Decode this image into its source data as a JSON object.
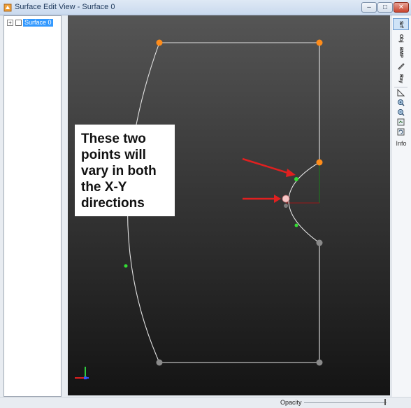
{
  "window": {
    "title": "Surface Edit View - Surface 0",
    "controls": {
      "minimize": "–",
      "maximize": "□",
      "close": "✕"
    }
  },
  "tree": {
    "items": [
      {
        "label": "Surface 0",
        "expander": "+",
        "checked": false,
        "selected": true
      }
    ]
  },
  "annotation": {
    "lines": [
      "These two",
      "points will",
      "vary in both",
      "the X-Y",
      "directions"
    ]
  },
  "toolbar": {
    "buttons": [
      {
        "label": "Srf",
        "active": true
      },
      {
        "label": "Obj",
        "active": false
      },
      {
        "label": "BMP",
        "active": false
      },
      {
        "label": "pencil-icon"
      },
      {
        "label": "Ray",
        "active": false
      }
    ],
    "tools": [
      "ruler-icon",
      "zoom-in-icon",
      "zoom-out-icon",
      "fit-icon",
      "reset-icon"
    ],
    "info_label": "Info"
  },
  "status": {
    "opacity_label": "Opacity"
  },
  "colors": {
    "accent_orange": "#ff8c1a",
    "control_green": "#33dd33",
    "selected_blue": "#3399ff",
    "arrow_red": "#e02020"
  }
}
